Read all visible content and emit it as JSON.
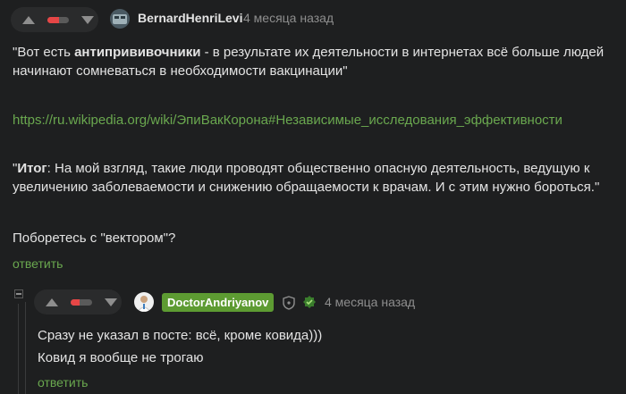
{
  "comment1": {
    "author": "BernardHenriLevi",
    "time": "4 месяца назад",
    "rating_negative_fraction": 0.55,
    "quote_open": "\"Вот есть ",
    "quote_bold": "антипрививочники",
    "quote_rest_line1": " - в результате их деятельности в интернетах всё больше людей",
    "quote_line2": "начинают сомневаться в необходимости вакцинации\"",
    "link": "https://ru.wikipedia.org/wiki/ЭпиВакКорона#Независимые_исследования_эффективности",
    "summary_open": "\"",
    "summary_bold": "Итог",
    "summary_rest_line1": ": На мой взгляд, такие люди проводят общественно опасную деятельность, ведущую к",
    "summary_line2": "увеличению заболеваемости и снижению обращаемости к врачам. И с этим нужно бороться.\"",
    "question": "Поборетесь с \"вектором\"?",
    "reply_label": "ответить"
  },
  "comment2": {
    "author": "DoctorAndriyanov",
    "time": "4 месяца назад",
    "rating_negative_fraction": 0.4,
    "line1": "Сразу не указал в посте: всё, кроме ковида)))",
    "line2": "Ковид я вообще не трогаю",
    "reply_label": "ответить"
  },
  "icons": {
    "shield": "shield-icon",
    "badge": "verified-doctor-icon"
  },
  "colors": {
    "background": "#1e1f20",
    "accent_green": "#6aa84f",
    "badge_green": "#5d9b32",
    "negative_red": "#e64646"
  }
}
